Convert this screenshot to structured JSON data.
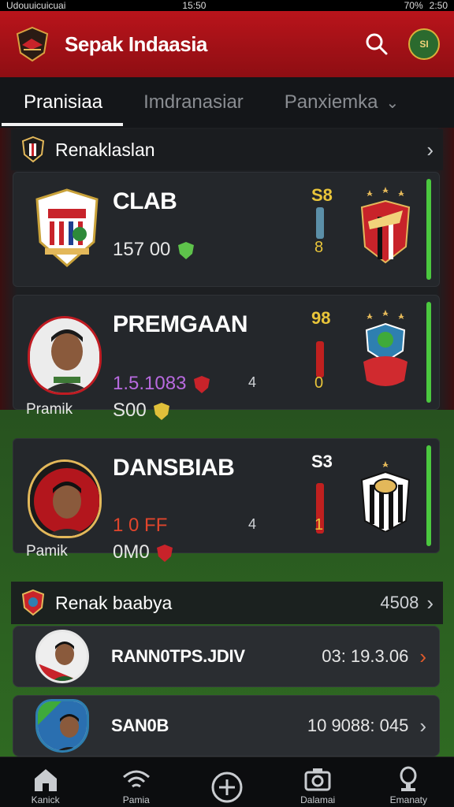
{
  "status_bar": {
    "left_text": "Udouuicuicuai",
    "time": "15:50",
    "battery": "70%",
    "right_text": "2:50"
  },
  "header": {
    "title": "Sepak Indaasia",
    "avatar_text": "SI"
  },
  "tabs": [
    {
      "label": "Pranisiaa"
    },
    {
      "label": "Imdranasiar"
    },
    {
      "label": "Panxiemka"
    }
  ],
  "section_1": {
    "title": "Renaklaslan"
  },
  "cards": [
    {
      "team_name": "CLAB",
      "stat_a": "157 00",
      "score_top": "S8",
      "score_bottom": "8",
      "side_label": "",
      "stat_b": "",
      "mid_num": ""
    },
    {
      "team_name": "PREMGAAN",
      "stat_a": "1.5.1083",
      "stat_b": "S00",
      "side_label": "Pramik",
      "mid_num": "4",
      "score_top": "98",
      "score_bottom": "0"
    },
    {
      "team_name": "DANSBIAB",
      "stat_a": "1 0 FF",
      "stat_b": "0M0",
      "side_label": "Pamik",
      "mid_num": "4",
      "score_top": "S3",
      "score_bottom": "1"
    }
  ],
  "section_2": {
    "title": "Renak baabya",
    "count": "4508"
  },
  "rows": [
    {
      "name": "RANN0TPS.JDIV",
      "meta": "03:  19.3.06",
      "chevron_color": "#e05a2b"
    },
    {
      "name": "SAN0B",
      "meta": "10 9088: 045",
      "chevron_color": "#c9ccd0"
    }
  ],
  "bottom_nav": [
    {
      "label": "Kanick",
      "icon": "home-icon"
    },
    {
      "label": "Pamia",
      "icon": "signal-icon"
    },
    {
      "label": "",
      "icon": "add-icon"
    },
    {
      "label": "Dalamai",
      "icon": "camera-icon"
    },
    {
      "label": "Emanaty",
      "icon": "trophy-icon"
    }
  ],
  "colors": {
    "header_red": "#b9141b",
    "accent_green": "#4bc83f",
    "bar_red": "#c0201f",
    "bar_blue": "#5b8fa8"
  }
}
